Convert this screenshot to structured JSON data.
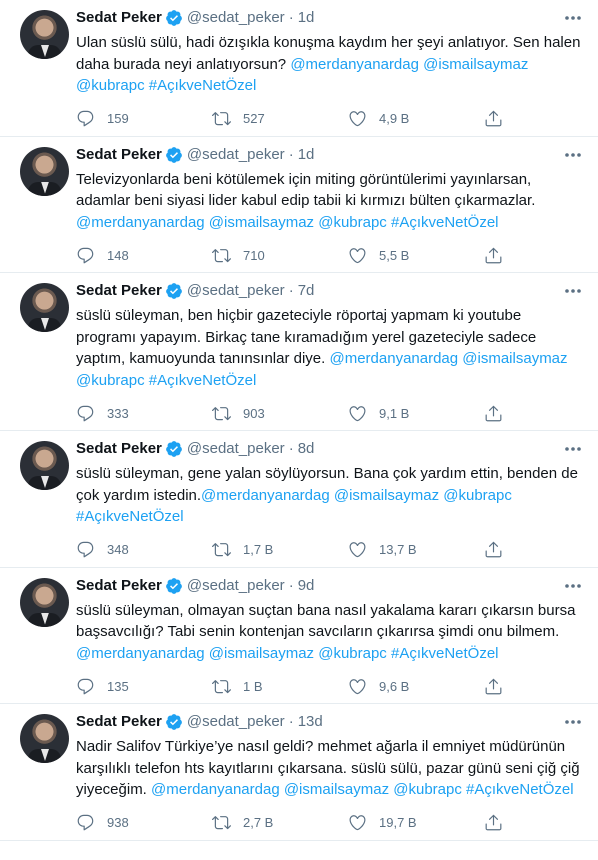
{
  "colors": {
    "link": "#1da1f2",
    "muted": "#5b7083",
    "text": "#0f1419",
    "divider": "#e6ecf0"
  },
  "tweets": [
    {
      "name": "Sedat Peker",
      "handle": "@sedat_peker",
      "sep": "·",
      "time": "1d",
      "text": "Ulan süslü sülü, hadi özışıkla konuşma kaydım her şeyi anlatıyor. Sen halen daha burada neyi anlatıyorsun? ",
      "links": "@merdanyanardag @ismailsaymaz @kubrapc #AçıkveNetÖzel",
      "replies": "159",
      "retweets": "527",
      "likes": "4,9 B"
    },
    {
      "name": "Sedat Peker",
      "handle": "@sedat_peker",
      "sep": "·",
      "time": "1d",
      "text": "Televizyonlarda beni kötülemek için miting görüntülerimi yayınlarsan, adamlar beni siyasi lider kabul edip tabii ki kırmızı bülten çıkarmazlar. ",
      "links": "@merdanyanardag @ismailsaymaz @kubrapc #AçıkveNetÖzel",
      "replies": "148",
      "retweets": "710",
      "likes": "5,5 B"
    },
    {
      "name": "Sedat Peker",
      "handle": "@sedat_peker",
      "sep": "·",
      "time": "7d",
      "text": "süslü süleyman, ben hiçbir gazeteciyle röportaj yapmam ki youtube programı yapayım. Birkaç tane kıramadığım yerel gazeteciyle sadece yaptım, kamuoyunda tanınsınlar diye. ",
      "links": "@merdanyanardag @ismailsaymaz @kubrapc #AçıkveNetÖzel",
      "replies": "333",
      "retweets": "903",
      "likes": "9,1 B"
    },
    {
      "name": "Sedat Peker",
      "handle": "@sedat_peker",
      "sep": "·",
      "time": "8d",
      "text": "süslü süleyman, gene yalan söylüyorsun. Bana çok yardım ettin, benden de çok yardım istedin.",
      "links": "@merdanyanardag @ismailsaymaz @kubrapc #AçıkveNetÖzel",
      "replies": "348",
      "retweets": "1,7 B",
      "likes": "13,7 B"
    },
    {
      "name": "Sedat Peker",
      "handle": "@sedat_peker",
      "sep": "·",
      "time": "9d",
      "text": "süslü süleyman, olmayan suçtan bana nasıl yakalama kararı çıkarsın bursa başsavcılığı? Tabi senin kontenjan savcıların çıkarırsa şimdi onu bilmem. ",
      "links": "@merdanyanardag @ismailsaymaz @kubrapc #AçıkveNetÖzel",
      "replies": "135",
      "retweets": "1 B",
      "likes": "9,6 B"
    },
    {
      "name": "Sedat Peker",
      "handle": "@sedat_peker",
      "sep": "·",
      "time": "13d",
      "text": "Nadir Salifov Türkiye’ye nasıl geldi? mehmet ağarla il emniyet müdürünün karşılıklı telefon hts kayıtlarını çıkarsana. süslü sülü, pazar günü seni çiğ çiğ yiyeceğim. ",
      "links": "@merdanyanardag @ismailsaymaz @kubrapc #AçıkveNetÖzel",
      "replies": "938",
      "retweets": "2,7 B",
      "likes": "19,7 B"
    }
  ]
}
